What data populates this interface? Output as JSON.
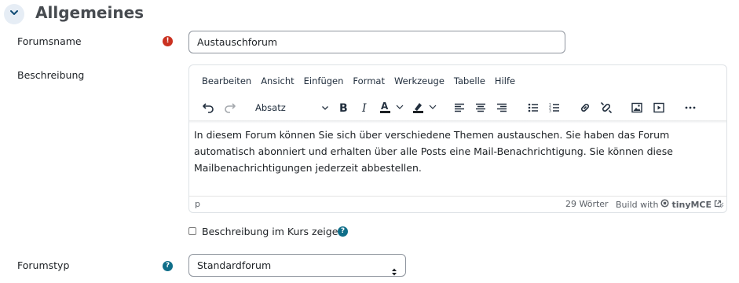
{
  "section": {
    "title": "Allgemeines",
    "toggle_icon": "chevron-down-icon"
  },
  "forumsname": {
    "label": "Forumsname",
    "value": "Austauschforum",
    "required_icon": "exclamation-icon"
  },
  "beschreibung": {
    "label": "Beschreibung",
    "menu": [
      "Bearbeiten",
      "Ansicht",
      "Einfügen",
      "Format",
      "Werkzeuge",
      "Tabelle",
      "Hilfe"
    ],
    "block_format": "Absatz",
    "toolbar_icons": [
      "undo-icon",
      "redo-icon",
      "bold-icon",
      "italic-icon",
      "text-color-icon",
      "highlight-icon",
      "align-left-icon",
      "align-center-icon",
      "align-right-icon",
      "bullet-list-icon",
      "numbered-list-icon",
      "link-icon",
      "unlink-icon",
      "image-icon",
      "media-icon",
      "more-icon"
    ],
    "content": "In diesem Forum können Sie sich über verschiedene Themen austauschen. Sie haben das Forum automatisch abonniert und erhalten über alle Posts eine Mail-Benachrichtigung. Sie können diese Mailbenachrichtigungen jederzeit abbestellen.",
    "status_path": "p",
    "word_count": "29 Wörter",
    "build_with": "Build with",
    "brand": "tinyMCE"
  },
  "show_in_course": {
    "label": "Beschreibung im Kurs zeigen",
    "checked": false
  },
  "forumstyp": {
    "label": "Forumstyp",
    "value": "Standardforum"
  },
  "colors": {
    "required": "#ca3120",
    "help": "#0f6e89",
    "toggle_bg": "#e6edf5",
    "text_color_bar": "#1d2125",
    "highlight_bar": "#1d2125"
  }
}
